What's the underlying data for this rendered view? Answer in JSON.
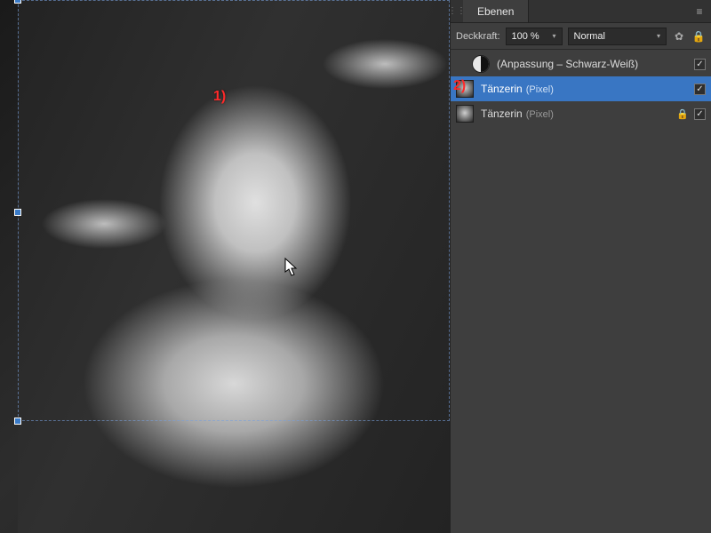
{
  "annotations": {
    "one": "1)",
    "two": "2)"
  },
  "panel": {
    "tab_label": "Ebenen",
    "opacity_label": "Deckkraft:",
    "opacity_value": "100 %",
    "blend_mode": "Normal"
  },
  "layers": [
    {
      "name": "(Anpassung – Schwarz-Weiß)",
      "type": "",
      "kind": "adjustment",
      "locked": false,
      "visible": true,
      "selected": false,
      "indent": true
    },
    {
      "name": "Tänzerin",
      "type": "(Pixel)",
      "kind": "pixel",
      "locked": false,
      "visible": true,
      "selected": true,
      "indent": false
    },
    {
      "name": "Tänzerin",
      "type": "(Pixel)",
      "kind": "pixel",
      "locked": true,
      "visible": true,
      "selected": false,
      "indent": false
    }
  ]
}
